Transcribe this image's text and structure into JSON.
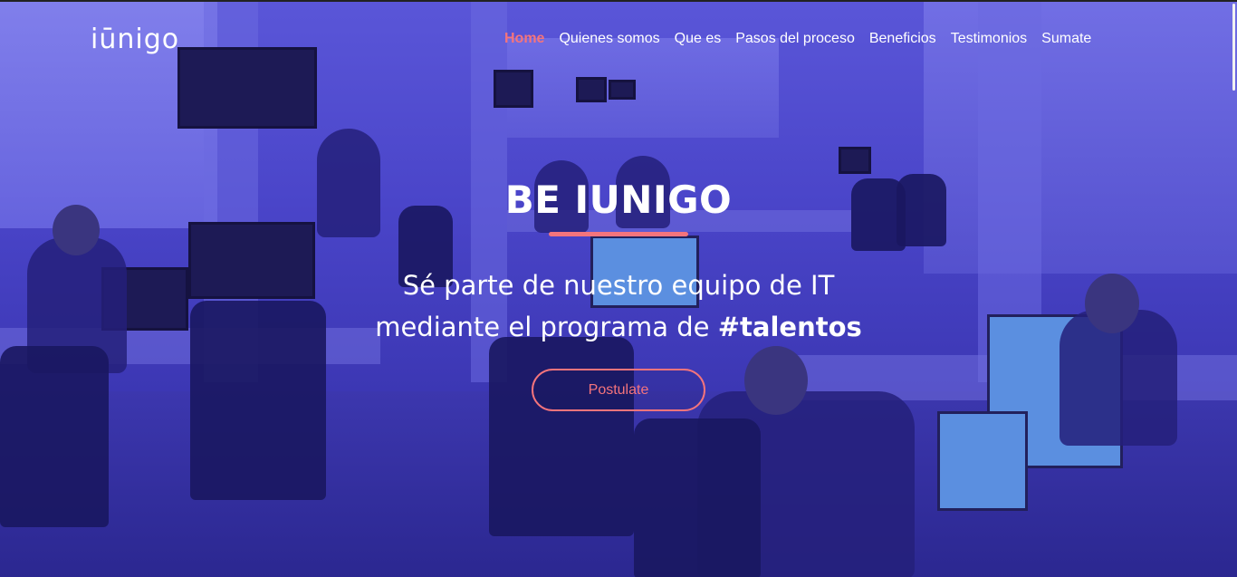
{
  "brand": {
    "logo_text": "iūnigo"
  },
  "nav": {
    "items": [
      {
        "label": "Home",
        "active": true
      },
      {
        "label": "Quienes somos",
        "active": false
      },
      {
        "label": "Que es",
        "active": false
      },
      {
        "label": "Pasos del proceso",
        "active": false
      },
      {
        "label": "Beneficios",
        "active": false
      },
      {
        "label": "Testimonios",
        "active": false
      },
      {
        "label": "Sumate",
        "active": false
      }
    ]
  },
  "hero": {
    "title": "BE IUNIGO",
    "subtitle_line1": "Sé parte de nuestro equipo de IT",
    "subtitle_line2_prefix": "mediante el programa de ",
    "subtitle_line2_bold": "#talentos",
    "cta_label": "Postulate"
  },
  "colors": {
    "accent": "#f4747c",
    "overlay": "#4a45c9",
    "text": "#ffffff"
  }
}
